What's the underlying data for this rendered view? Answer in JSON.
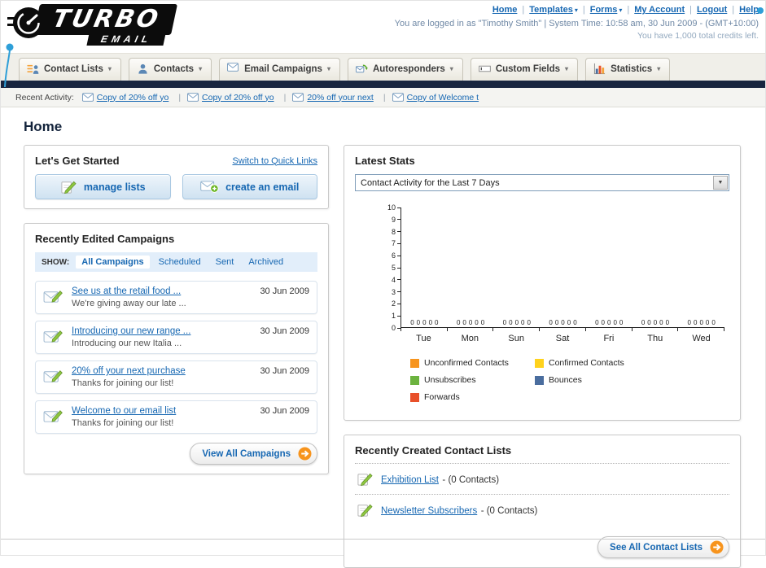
{
  "header": {
    "logo": {
      "title": "TURBO",
      "subtitle": "EMAIL"
    },
    "nav": [
      {
        "label": "Home",
        "dropdown": false
      },
      {
        "label": "Templates",
        "dropdown": true
      },
      {
        "label": "Forms",
        "dropdown": true
      },
      {
        "label": "My Account",
        "dropdown": false
      },
      {
        "label": "Logout",
        "dropdown": false
      },
      {
        "label": "Help",
        "dropdown": false
      }
    ],
    "login_info": "You are logged in as \"Timothy Smith\" | System Time: 10:58 am, 30 Jun 2009 - (GMT+10:00)",
    "credits_info": "You have 1,000 total credits left."
  },
  "nav_tabs": [
    {
      "label": "Contact Lists",
      "icon": "people-list"
    },
    {
      "label": "Contacts",
      "icon": "contacts"
    },
    {
      "label": "Email Campaigns",
      "icon": "envelope"
    },
    {
      "label": "Autoresponders",
      "icon": "autoresponder"
    },
    {
      "label": "Custom Fields",
      "icon": "field"
    },
    {
      "label": "Statistics",
      "icon": "chart"
    }
  ],
  "recent_activity": {
    "label": "Recent Activity:",
    "items": [
      {
        "label": "Copy of 20% off yo"
      },
      {
        "label": "Copy of 20% off yo"
      },
      {
        "label": "20% off your next"
      },
      {
        "label": "Copy of Welcome t"
      }
    ]
  },
  "page": {
    "title": "Home"
  },
  "get_started": {
    "title": "Let's Get Started",
    "switch_link": "Switch to Quick Links",
    "manage_lists_label": "manage lists",
    "create_email_label": "create an email"
  },
  "campaigns": {
    "title": "Recently Edited Campaigns",
    "show_label": "SHOW:",
    "filters": [
      {
        "label": "All Campaigns",
        "active": true
      },
      {
        "label": "Scheduled",
        "active": false
      },
      {
        "label": "Sent",
        "active": false
      },
      {
        "label": "Archived",
        "active": false
      }
    ],
    "items": [
      {
        "title": "See us at the retail food ...",
        "subtitle": "We're giving away our late ...",
        "date": "30 Jun 2009"
      },
      {
        "title": "Introducing our new range ...",
        "subtitle": "Introducing our new Italia ...",
        "date": "30 Jun 2009"
      },
      {
        "title": "20% off your next purchase",
        "subtitle": "Thanks for joining our list!",
        "date": "30 Jun 2009"
      },
      {
        "title": "Welcome to our email list",
        "subtitle": "Thanks for joining our list!",
        "date": "30 Jun 2009"
      }
    ],
    "view_all_label": "View All Campaigns"
  },
  "stats": {
    "title": "Latest Stats",
    "selected_option": "Contact Activity for the Last 7 Days",
    "chart_data": {
      "type": "bar",
      "title": "Contact Activity for the Last 7 Days",
      "categories": [
        "Tue",
        "Mon",
        "Sun",
        "Sat",
        "Fri",
        "Thu",
        "Wed"
      ],
      "series": [
        {
          "name": "Unconfirmed Contacts",
          "color": "#f7941d",
          "values": [
            0,
            0,
            0,
            0,
            0,
            0,
            0
          ]
        },
        {
          "name": "Confirmed Contacts",
          "color": "#ffd21c",
          "values": [
            0,
            0,
            0,
            0,
            0,
            0,
            0
          ]
        },
        {
          "name": "Unsubscribes",
          "color": "#6cb33f",
          "values": [
            0,
            0,
            0,
            0,
            0,
            0,
            0
          ]
        },
        {
          "name": "Bounces",
          "color": "#4a6d9e",
          "values": [
            0,
            0,
            0,
            0,
            0,
            0,
            0
          ]
        },
        {
          "name": "Forwards",
          "color": "#e8502a",
          "values": [
            0,
            0,
            0,
            0,
            0,
            0,
            0
          ]
        }
      ],
      "ylim": [
        0,
        10
      ],
      "y_ticks": [
        0,
        1,
        2,
        3,
        4,
        5,
        6,
        7,
        8,
        9,
        10
      ],
      "grid": false,
      "legend_position": "bottom"
    }
  },
  "contact_lists": {
    "title": "Recently Created Contact Lists",
    "items": [
      {
        "name": "Exhibition List",
        "detail": "- (0 Contacts)"
      },
      {
        "name": "Newsletter Subscribers",
        "detail": "- (0 Contacts)"
      }
    ],
    "see_all_label": "See All Contact Lists"
  }
}
